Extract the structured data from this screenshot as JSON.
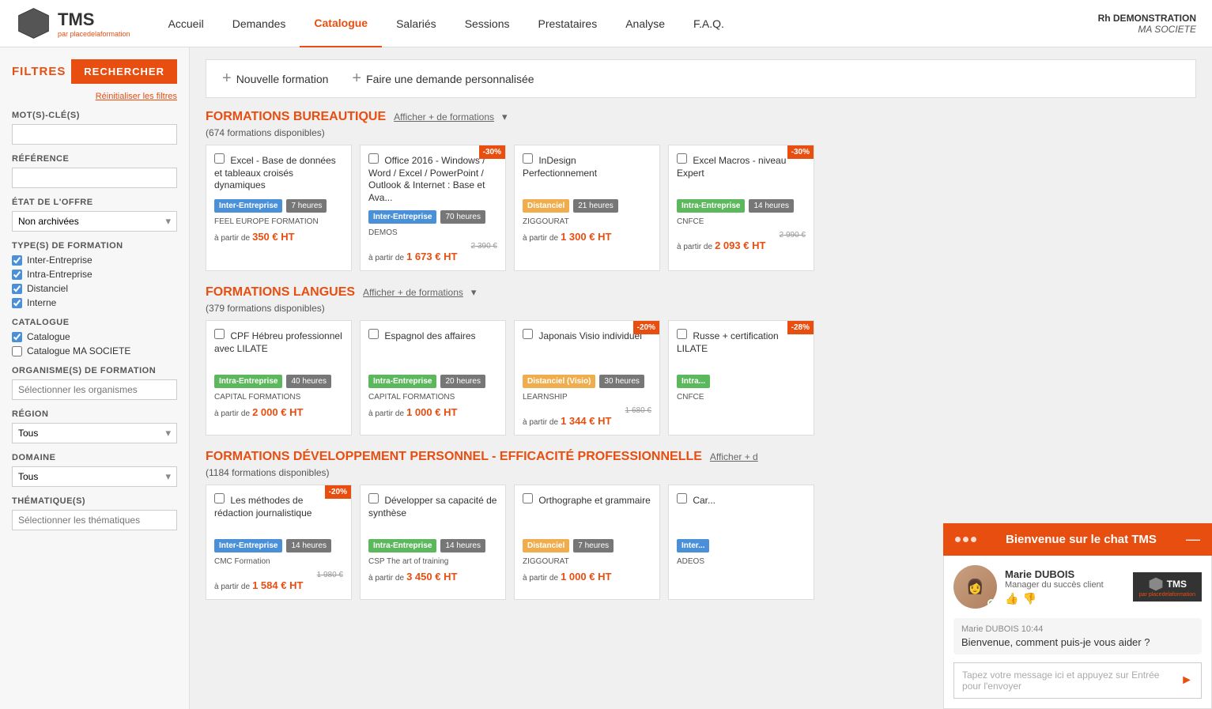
{
  "header": {
    "logo_text": "TMS",
    "logo_sub": "par placedelaformation",
    "nav_items": [
      {
        "label": "Accueil",
        "active": false
      },
      {
        "label": "Demandes",
        "active": false
      },
      {
        "label": "Catalogue",
        "active": true
      },
      {
        "label": "Salariés",
        "active": false
      },
      {
        "label": "Sessions",
        "active": false
      },
      {
        "label": "Prestataires",
        "active": false
      },
      {
        "label": "Analyse",
        "active": false
      },
      {
        "label": "F.A.Q.",
        "active": false
      }
    ],
    "user_name": "Rh DEMONSTRATION",
    "user_company": "MA SOCIETE"
  },
  "sidebar": {
    "title": "FILTRES",
    "search_btn": "RECHERCHER",
    "reset_link": "Réinitialiser les filtres",
    "keyword_label": "MOT(S)-CLÉ(S)",
    "keyword_placeholder": "",
    "reference_label": "RÉFÉRENCE",
    "reference_placeholder": "",
    "etat_label": "ÉTAT DE L'OFFRE",
    "etat_value": "Non archivées",
    "types_label": "TYPE(S) DE FORMATION",
    "types": [
      {
        "label": "Inter-Entreprise",
        "checked": true
      },
      {
        "label": "Intra-Entreprise",
        "checked": true
      },
      {
        "label": "Distanciel",
        "checked": true
      },
      {
        "label": "Interne",
        "checked": true
      }
    ],
    "catalogue_label": "CATALOGUE",
    "catalogues": [
      {
        "label": "Catalogue",
        "checked": true
      },
      {
        "label": "Catalogue MA SOCIETE",
        "checked": false
      }
    ],
    "organisme_label": "ORGANISME(S) DE FORMATION",
    "organisme_placeholder": "Sélectionner les organismes",
    "region_label": "RÉGION",
    "region_value": "Tous",
    "domaine_label": "DOMAINE",
    "domaine_value": "Tous",
    "thematique_label": "THÉMATIQUE(S)",
    "thematique_placeholder": "Sélectionner les thématiques"
  },
  "actions": [
    {
      "label": "Nouvelle formation"
    },
    {
      "label": "Faire une demande personnalisée"
    }
  ],
  "sections": [
    {
      "id": "bureautique",
      "title": "FORMATIONS",
      "title_colored": "BUREAUTIQUE",
      "link": "Afficher + de formations",
      "count": "674 formations disponibles",
      "cards": [
        {
          "title": "Excel - Base de données et tableaux croisés dynamiques",
          "tag": "Inter-Entreprise",
          "tag_type": "inter",
          "hours": "7 heures",
          "provider": "FEEL EUROPE FORMATION",
          "old_price": null,
          "price": "350 € HT",
          "price_prefix": "à partir de",
          "badge": null
        },
        {
          "title": "Office 2016 - Windows / Word / Excel / PowerPoint / Outlook & Internet : Base et Ava...",
          "tag": "Inter-Entreprise",
          "tag_type": "inter",
          "hours": "70 heures",
          "provider": "DEMOS",
          "old_price": "2 390 €",
          "price": "1 673 € HT",
          "price_prefix": "à partir de",
          "badge": "-30%"
        },
        {
          "title": "InDesign Perfectionnement",
          "tag": "Distanciel",
          "tag_type": "distanciel",
          "hours": "21 heures",
          "provider": "ZIGGOURAT",
          "old_price": null,
          "price": "1 300 € HT",
          "price_prefix": "à partir de",
          "badge": null
        },
        {
          "title": "Excel Macros - niveau Expert",
          "tag": "Intra-Entreprise",
          "tag_type": "intra",
          "hours": "14 heures",
          "provider": "CNFCE",
          "old_price": "2 990 €",
          "price": "2 093 € HT",
          "price_prefix": "à partir de",
          "badge": "-30%"
        }
      ]
    },
    {
      "id": "langues",
      "title": "FORMATIONS",
      "title_colored": "LANGUES",
      "link": "Afficher + de formations",
      "count": "379 formations disponibles",
      "cards": [
        {
          "title": "CPF Hébreu professionnel avec LILATE",
          "tag": "Intra-Entreprise",
          "tag_type": "intra",
          "hours": "40 heures",
          "provider": "CAPITAL FORMATIONS",
          "old_price": null,
          "price": "2 000 € HT",
          "price_prefix": "à partir de",
          "badge": null
        },
        {
          "title": "Espagnol des affaires",
          "tag": "Intra-Entreprise",
          "tag_type": "intra",
          "hours": "20 heures",
          "provider": "CAPITAL FORMATIONS",
          "old_price": null,
          "price": "1 000 € HT",
          "price_prefix": "à partir de",
          "badge": null
        },
        {
          "title": "Japonais Visio individuel",
          "tag": "Distanciel (Visio)",
          "tag_type": "distanciel-visio",
          "hours": "30 heures",
          "provider": "LEARNSHIP",
          "old_price": "1 680 €",
          "price": "1 344 € HT",
          "price_prefix": "à partir de",
          "badge": "-20%"
        },
        {
          "title": "Russe + certification LILATE",
          "tag": "Intra...",
          "tag_type": "intra",
          "hours": "",
          "provider": "CNFCE",
          "old_price": null,
          "price": null,
          "price_prefix": "",
          "badge": "-28%"
        }
      ]
    },
    {
      "id": "dev-perso",
      "title": "FORMATIONS",
      "title_colored": "DÉVELOPPEMENT PERSONNEL - EFFICACITÉ PROFESSIONNELLE",
      "link": "Afficher + d",
      "count": "1184 formations disponibles",
      "cards": [
        {
          "title": "Les méthodes de rédaction journalistique",
          "tag": "Inter-Entreprise",
          "tag_type": "inter",
          "hours": "14 heures",
          "provider": "CMC Formation",
          "old_price": "1 980 €",
          "price": "1 584 € HT",
          "price_prefix": "à partir de",
          "badge": "-20%"
        },
        {
          "title": "Développer sa capacité de synthèse",
          "tag": "Intra-Entreprise",
          "tag_type": "intra",
          "hours": "14 heures",
          "provider": "CSP The art of training",
          "old_price": null,
          "price": "3 450 € HT",
          "price_prefix": "à partir de",
          "badge": null
        },
        {
          "title": "Orthographe et grammaire",
          "tag": "Distanciel",
          "tag_type": "distanciel",
          "hours": "7 heures",
          "provider": "ZIGGOURAT",
          "old_price": null,
          "price": "1 000 € HT",
          "price_prefix": "à partir de",
          "badge": null
        },
        {
          "title": "Car...",
          "tag": "Inter...",
          "tag_type": "inter",
          "hours": "",
          "provider": "ADEOS",
          "old_price": null,
          "price": null,
          "price_prefix": "",
          "badge": null
        }
      ]
    }
  ],
  "chat": {
    "title": "Bienvenue sur le chat TMS",
    "agent_name": "Marie DUBOIS",
    "agent_role": "Manager du succès client",
    "message_author": "Marie DUBOIS 10:44",
    "message_text": "Bienvenue, comment puis-je vous aider ?",
    "input_placeholder": "Tapez votre message ici et appuyez sur Entrée pour l'envoyer"
  }
}
